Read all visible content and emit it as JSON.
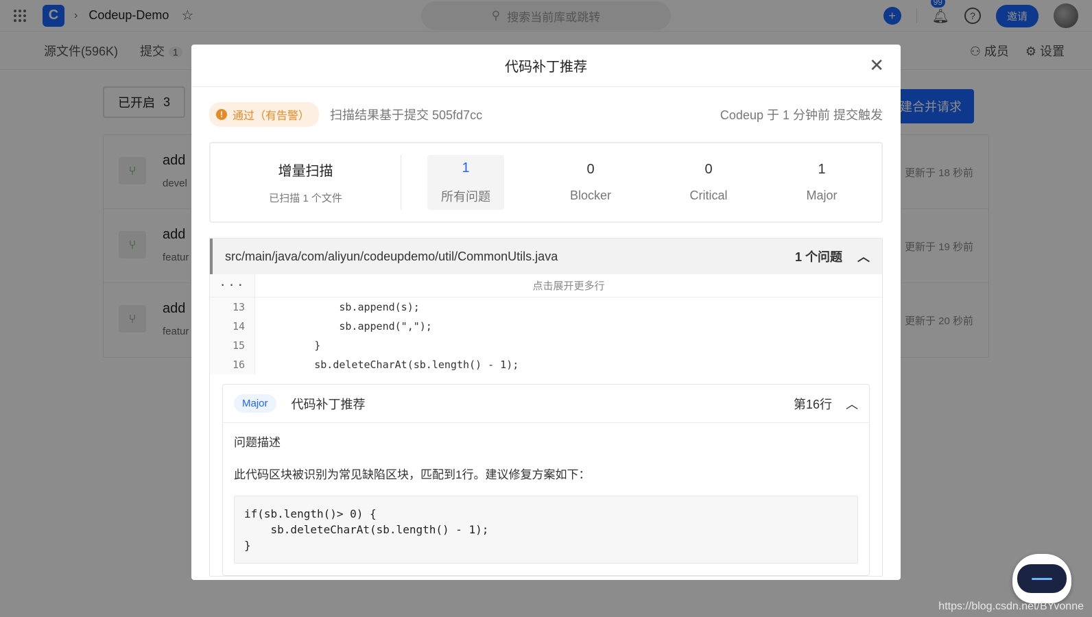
{
  "topbar": {
    "repo_name": "Codeup-Demo",
    "search_placeholder": "搜索当前库或跳转",
    "notif_count": "99",
    "invite_label": "邀请"
  },
  "subnav": {
    "tab_source": "源文件(596K)",
    "tab_commits": "提交",
    "tab_commits_count": "1",
    "members": "成员",
    "settings": "设置"
  },
  "merge_requests": {
    "filter_label": "已开启",
    "filter_count": "3",
    "new_button": "新建合并请求",
    "rows": [
      {
        "title": "add",
        "branch": "devel",
        "updated": "更新于 18 秒前"
      },
      {
        "title": "add",
        "branch": "featur",
        "updated": "更新于 19 秒前"
      },
      {
        "title": "add",
        "branch": "featur",
        "updated": "更新于 20 秒前"
      }
    ]
  },
  "modal": {
    "title": "代码补丁推荐",
    "status_badge": "通过（有告警）",
    "scan_basis": "扫描结果基于提交 505fd7cc",
    "trigger": "Codeup 于 1 分钟前 提交触发",
    "incremental": {
      "title": "增量扫描",
      "subtitle": "已扫描 1 个文件"
    },
    "stats": [
      {
        "value": "1",
        "label": "所有问题"
      },
      {
        "value": "0",
        "label": "Blocker"
      },
      {
        "value": "0",
        "label": "Critical"
      },
      {
        "value": "1",
        "label": "Major"
      }
    ],
    "file": {
      "path": "src/main/java/com/aliyun/codeupdemo/util/CommonUtils.java",
      "issue_count": "1 个问题",
      "expand_text": "点击展开更多行",
      "expand_dots": "···",
      "lines": [
        {
          "num": "13",
          "code": "            sb.append(s);"
        },
        {
          "num": "14",
          "code": "            sb.append(\",\");"
        },
        {
          "num": "15",
          "code": "        }"
        },
        {
          "num": "16",
          "code": "        sb.deleteCharAt(sb.length() - 1);"
        }
      ]
    },
    "issue": {
      "severity": "Major",
      "title": "代码补丁推荐",
      "line": "第16行",
      "desc_heading": "问题描述",
      "description": "此代码区块被识别为常见缺陷区块，匹配到1行。建议修复方案如下：",
      "fix_code": "if(sb.length()> 0) {\n    sb.deleteCharAt(sb.length() - 1);\n}"
    }
  },
  "watermark": "https://blog.csdn.net/BYvonne",
  "colors": {
    "accent": "#1b66ff",
    "warning": "#e58a24"
  }
}
